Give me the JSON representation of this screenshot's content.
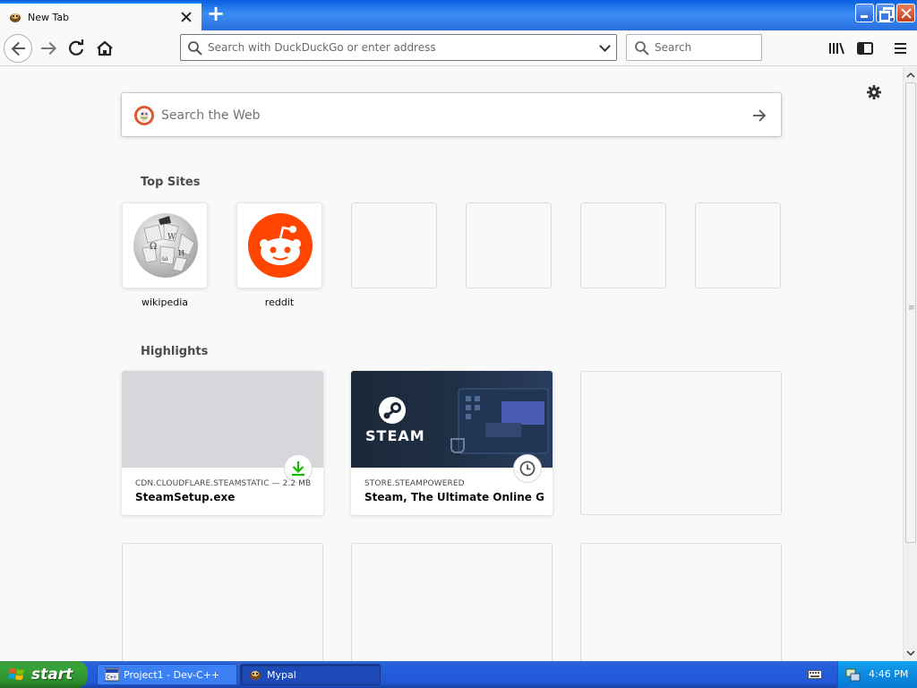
{
  "browser": {
    "tab": {
      "title": "New Tab",
      "new_tab_symbol": "+"
    },
    "window_controls": {
      "minimize": "minimize",
      "maximize": "maximize",
      "close": "close"
    },
    "navbar": {
      "url_placeholder": "Search with DuckDuckGo or enter address",
      "search_placeholder": "Search",
      "icons": [
        "back-arrow-icon",
        "forward-arrow-icon",
        "reload-icon",
        "home-icon",
        "library-icon",
        "sidebars-icon",
        "hamburger-menu-icon"
      ]
    }
  },
  "newtab": {
    "search": {
      "placeholder": "Search the Web",
      "engine_icon": "duckduckgo-icon"
    },
    "top_sites": {
      "title": "Top Sites",
      "tiles": [
        {
          "label": "wikipedia",
          "icon": "wikipedia-globe-icon"
        },
        {
          "label": "reddit",
          "icon": "reddit-alien-icon"
        },
        {
          "label": ""
        },
        {
          "label": ""
        },
        {
          "label": ""
        },
        {
          "label": ""
        }
      ]
    },
    "highlights": {
      "title": "Highlights",
      "cards": [
        {
          "host": "CDN.CLOUDFLARE.STEAMSTATIC — 2.2 MB",
          "title": "SteamSetup.exe",
          "badge": "download-icon"
        },
        {
          "host": "STORE.STEAMPOWERED",
          "title": "Steam, The Ultimate Online Ga...",
          "badge": "clock-icon",
          "thumb_text": "STEAM"
        }
      ]
    }
  },
  "taskbar": {
    "start_label": "start",
    "tasks": [
      {
        "label": "Project1 - Dev-C++",
        "icon": "devcpp-icon"
      },
      {
        "label": "Mypal",
        "icon": "mypal-icon"
      }
    ],
    "clock": "4:46 PM"
  },
  "colors": {
    "accent": "#0a84ff",
    "reddit": "#ff4500",
    "steam_bg": "#1b2838",
    "download_green": "#12bc00",
    "taskbar_blue": "#245edb",
    "start_green": "#36a236"
  }
}
